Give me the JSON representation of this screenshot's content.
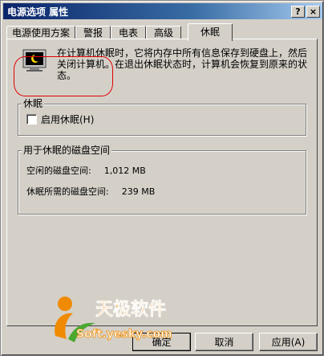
{
  "window": {
    "title": "电源选项 属性",
    "help_button": "?",
    "close_button": "×"
  },
  "tabs": [
    {
      "label": "电源使用方案",
      "active": false
    },
    {
      "label": "警报",
      "active": false
    },
    {
      "label": "电表",
      "active": false
    },
    {
      "label": "高级",
      "active": false
    },
    {
      "label": "休眠",
      "active": true
    }
  ],
  "hibernate": {
    "description": "在计算机休眠时，它将内存中所有信息保存到硬盘上，然后关闭计算机。在退出休眠状态时，计算机会恢复到原来的状态。",
    "group_label": "休眠",
    "checkbox_label": "启用休眠(H)",
    "checkbox_checked": false
  },
  "disk_space": {
    "group_label": "用于休眠的磁盘空间",
    "free_label": "空闲的磁盘空间:",
    "free_value": "1,012 MB",
    "required_label": "休眠所需的磁盘空间:",
    "required_value": "239 MB"
  },
  "buttons": {
    "ok": "确定",
    "cancel": "取消",
    "apply": "应用(A)"
  },
  "watermark": {
    "brand": "天极软件",
    "site": "Soft.yesky.com"
  },
  "colors": {
    "dialog_face": "#d4d0c8",
    "title_start": "#0a246a",
    "title_end": "#a6caf0",
    "highlight_circle": "#e00000",
    "watermark_orange": "#f08a00",
    "watermark_green": "#4aa832"
  }
}
